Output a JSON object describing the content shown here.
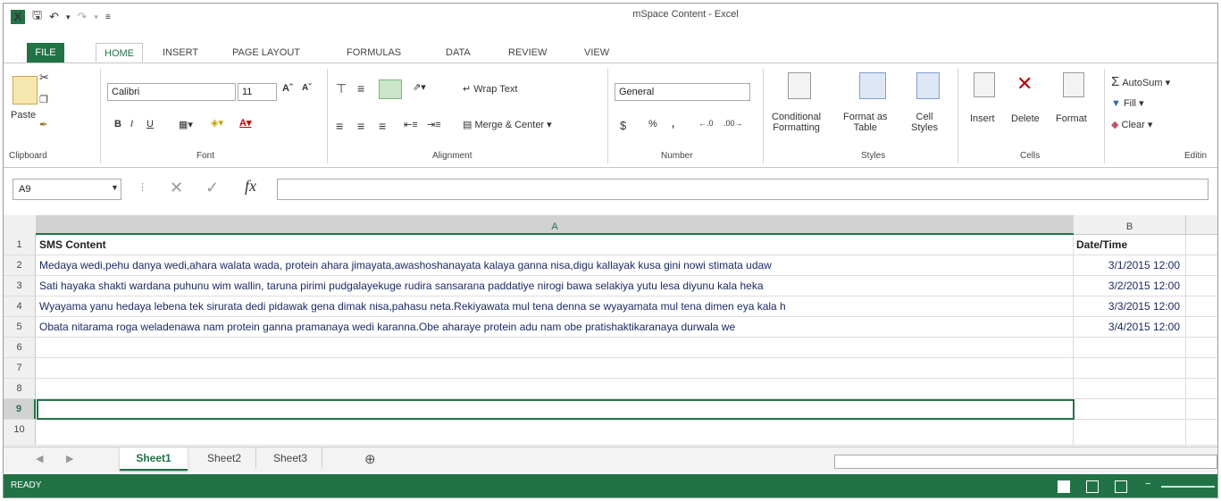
{
  "window": {
    "title": "mSpace Content - Excel"
  },
  "tabs": [
    "FILE",
    "HOME",
    "INSERT",
    "PAGE LAYOUT",
    "FORMULAS",
    "DATA",
    "REVIEW",
    "VIEW"
  ],
  "ribbon": {
    "clipboard": {
      "paste": "Paste",
      "label": "Clipboard"
    },
    "font": {
      "name": "Calibri",
      "size": "11",
      "label": "Font",
      "bold": "B",
      "italic": "I",
      "underline": "U"
    },
    "alignment": {
      "wrap": "Wrap Text",
      "merge": "Merge & Center",
      "label": "Alignment"
    },
    "number": {
      "format": "General",
      "currency": "$",
      "percent": "%",
      "comma": ",",
      "label": "Number"
    },
    "styles": {
      "conditional": "Conditional",
      "conditional2": "Formatting",
      "format_as": "Format as",
      "format_as2": "Table",
      "cell": "Cell",
      "cell2": "Styles",
      "label": "Styles"
    },
    "cells": {
      "insert": "Insert",
      "delete": "Delete",
      "format": "Format",
      "label": "Cells"
    },
    "editing": {
      "autosum": "AutoSum",
      "fill": "Fill",
      "clear": "Clear",
      "label": "Editin"
    }
  },
  "formula_bar": {
    "name_box": "A9",
    "fx": "fx",
    "value": ""
  },
  "columns": [
    "A",
    "B"
  ],
  "rows": [
    {
      "num": "1",
      "a": "SMS Content",
      "b": "Date/Time"
    },
    {
      "num": "2",
      "a": "Medaya wedi,pehu danya wedi,ahara walata wada, protein ahara jimayata,awashoshanayata kalaya ganna nisa,digu kallayak kusa gini nowi stimata udaw",
      "b": "3/1/2015 12:00"
    },
    {
      "num": "3",
      "a": "Sati hayaka shakti wardana puhunu wim wallin, taruna pirimi pudgalayekuge rudira sansarana paddatiye nirogi bawa selakiya yutu lesa diyunu kala heka",
      "b": "3/2/2015 12:00"
    },
    {
      "num": "4",
      "a": "Wyayama yanu hedaya lebena tek sirurata dedi pidawak gena dimak nisa,pahasu neta.Rekiyawata mul tena denna se wyayamata mul tena dimen eya kala h",
      "b": "3/3/2015 12:00"
    },
    {
      "num": "5",
      "a": "Obata nitarama roga weladenawa nam protein ganna pramanaya wedi karanna.Obe aharaye protein adu nam obe pratishaktikaranaya durwala we",
      "b": "3/4/2015 12:00"
    },
    {
      "num": "6",
      "a": "",
      "b": ""
    },
    {
      "num": "7",
      "a": "",
      "b": ""
    },
    {
      "num": "8",
      "a": "",
      "b": ""
    },
    {
      "num": "9",
      "a": "",
      "b": ""
    },
    {
      "num": "10",
      "a": "",
      "b": ""
    }
  ],
  "sheets": [
    "Sheet1",
    "Sheet2",
    "Sheet3"
  ],
  "status": {
    "text": "READY"
  },
  "colors": {
    "accent": "#217346"
  }
}
